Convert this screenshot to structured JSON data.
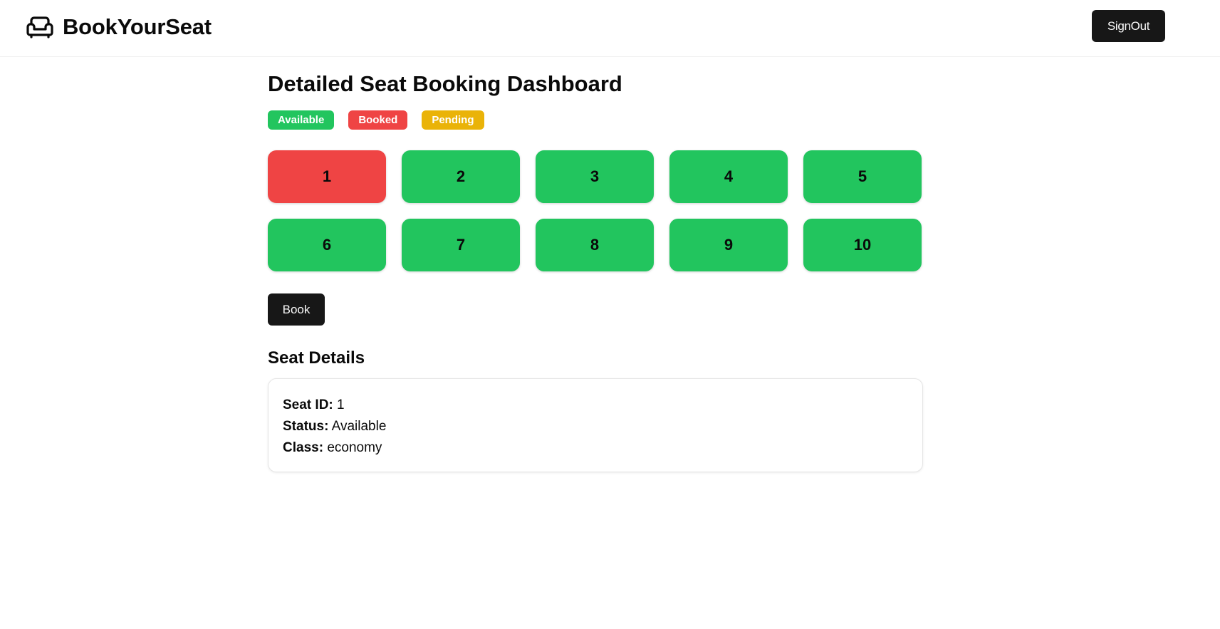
{
  "header": {
    "brand_name": "BookYourSeat",
    "brand_icon": "sofa-icon",
    "signout_label": "SignOut"
  },
  "main": {
    "title": "Detailed Seat Booking Dashboard",
    "legend": [
      {
        "label": "Available",
        "color": "#22c55e"
      },
      {
        "label": "Booked",
        "color": "#ef4444"
      },
      {
        "label": "Pending",
        "color": "#eab308"
      }
    ],
    "seats": [
      {
        "number": "1",
        "status": "booked"
      },
      {
        "number": "2",
        "status": "available"
      },
      {
        "number": "3",
        "status": "available"
      },
      {
        "number": "4",
        "status": "available"
      },
      {
        "number": "5",
        "status": "available"
      },
      {
        "number": "6",
        "status": "available"
      },
      {
        "number": "7",
        "status": "available"
      },
      {
        "number": "8",
        "status": "available"
      },
      {
        "number": "9",
        "status": "available"
      },
      {
        "number": "10",
        "status": "available"
      }
    ],
    "status_colors": {
      "available": "#22c55e",
      "booked": "#ef4444",
      "pending": "#eab308"
    },
    "book_label": "Book",
    "details": {
      "heading": "Seat Details",
      "seat_id_label": "Seat ID:",
      "seat_id_value": "1",
      "status_label": "Status:",
      "status_value": "Available",
      "class_label": "Class:",
      "class_value": "economy"
    }
  }
}
